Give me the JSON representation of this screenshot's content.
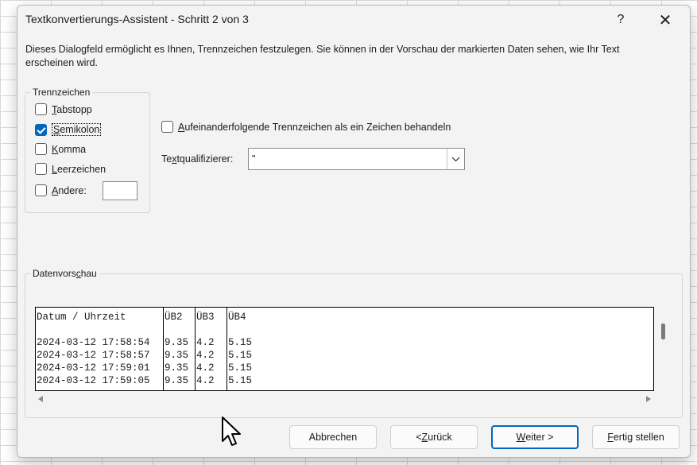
{
  "dialog": {
    "title": "Textkonvertierungs-Assistent - Schritt 2 von 3",
    "help_label": "?",
    "close_label": "✕",
    "description": "Dieses Dialogfeld ermöglicht es Ihnen, Trennzeichen festzulegen. Sie können in der Vorschau der markierten Daten sehen, wie Ihr Text erscheinen wird."
  },
  "trennzeichen": {
    "legend": "Trennzeichen",
    "options": [
      {
        "pre": "",
        "acc": "T",
        "post": "abstopp",
        "checked": false
      },
      {
        "pre": "",
        "acc": "S",
        "post": "emikolon",
        "checked": true
      },
      {
        "pre": "",
        "acc": "K",
        "post": "omma",
        "checked": false
      },
      {
        "pre": "",
        "acc": "L",
        "post": "eerzeichen",
        "checked": false
      },
      {
        "pre": "",
        "acc": "A",
        "post": "ndere:",
        "checked": false
      }
    ],
    "andere_value": ""
  },
  "consecutive": {
    "pre": "",
    "acc": "A",
    "post": "ufeinanderfolgende Trennzeichen als ein Zeichen behandeln",
    "checked": false
  },
  "qualifier": {
    "label_pre": "Te",
    "label_acc": "x",
    "label_post": "tqualifizierer:",
    "value": "\""
  },
  "preview": {
    "legend_pre": "Datenvors",
    "legend_acc": "c",
    "legend_post": "hau",
    "columns": [
      [
        "Datum / Uhrzeit",
        "",
        "2024-03-12 17:58:54",
        "2024-03-12 17:58:57",
        "2024-03-12 17:59:01",
        "2024-03-12 17:59:05"
      ],
      [
        "ÜB2",
        "",
        "9.35",
        "9.35",
        "9.35",
        "9.35"
      ],
      [
        "ÜB3",
        "",
        "4.2",
        "4.2",
        "4.2",
        "4.2"
      ],
      [
        "ÜB4",
        "",
        "5.15",
        "5.15",
        "5.15",
        "5.15"
      ]
    ]
  },
  "buttons": {
    "cancel": "Abbrechen",
    "back_pre": "< ",
    "back_acc": "Z",
    "back_post": "urück",
    "next_pre": "",
    "next_acc": "W",
    "next_post": "eiter >",
    "finish_pre": "",
    "finish_acc": "F",
    "finish_post": "ertig stellen"
  }
}
